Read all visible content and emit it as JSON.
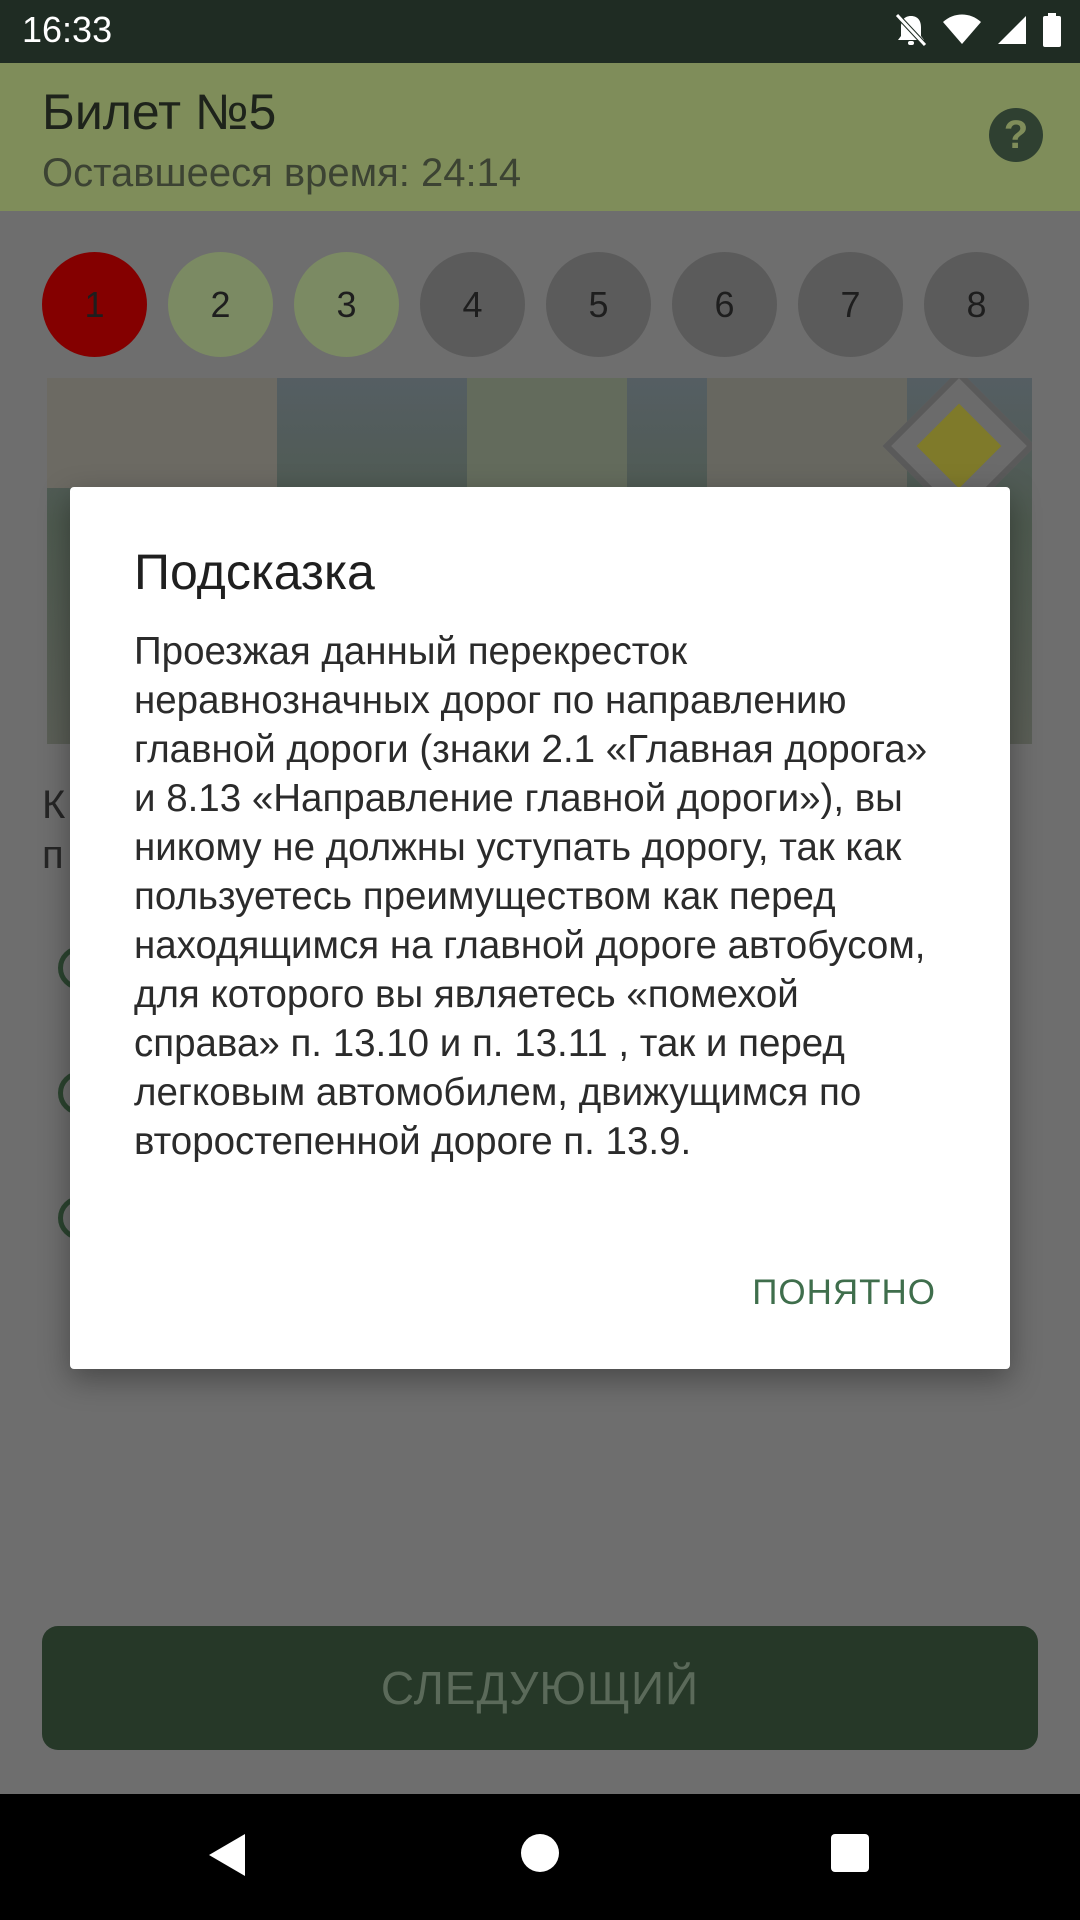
{
  "status_bar": {
    "time": "16:33",
    "icons": [
      "bell-off-icon",
      "wifi-icon",
      "signal-icon",
      "battery-icon"
    ]
  },
  "app_bar": {
    "title": "Билет №5",
    "subtitle": "Оставшееся время: 24:14",
    "help_glyph": "?"
  },
  "question_tabs": [
    {
      "label": "1",
      "state": "current"
    },
    {
      "label": "2",
      "state": "done"
    },
    {
      "label": "3",
      "state": "done"
    },
    {
      "label": "4",
      "state": "pending"
    },
    {
      "label": "5",
      "state": "pending"
    },
    {
      "label": "6",
      "state": "pending"
    },
    {
      "label": "7",
      "state": "pending"
    },
    {
      "label": "8",
      "state": "pending"
    }
  ],
  "question": {
    "line1_start": "К",
    "line2_start": "п"
  },
  "next_button": {
    "label": "СЛЕДУЮЩИЙ"
  },
  "dialog": {
    "title": "Подсказка",
    "body": "Проезжая данный перекресток неравнозначных дорог по направлению главной дороги (знаки 2.1 «Главная дорога» и 8.13 «Направление главной дороги»), вы никому не должны уступать дорогу, так как пользуетесь преимуществом как перед находящимся на главной дороге автобусом, для которого вы являетесь «помехой справа» п. 13.10 и п. 13.11 , так и перед легковым автомобилем, движущимся по второстепенной дороге п. 13.9.",
    "ok_label": "ПОНЯТНО"
  },
  "colors": {
    "status_bar": "#1f2c23",
    "app_bar": "#7f8d5a",
    "current_tab": "#840000",
    "done_tab": "#7b8a63",
    "accent": "#3f6e4c",
    "next_button": "#263828"
  }
}
